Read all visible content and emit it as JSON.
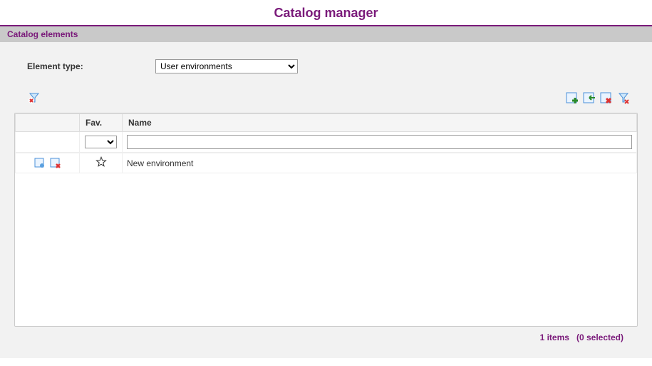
{
  "page_title": "Catalog manager",
  "section_title": "Catalog elements",
  "field": {
    "element_type_label": "Element type:",
    "element_type_value": "User environments"
  },
  "grid": {
    "headers": {
      "actions": "",
      "fav": "Fav.",
      "name": "Name"
    },
    "filter": {
      "name_value": ""
    },
    "rows": [
      {
        "name": "New environment",
        "favorite": false
      }
    ]
  },
  "status": {
    "items_text": "1 items",
    "selected_text": "(0 selected)"
  }
}
